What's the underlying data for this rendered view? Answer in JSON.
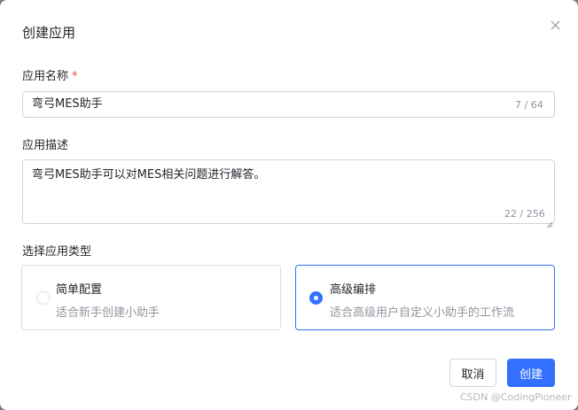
{
  "dialog": {
    "title": "创建应用",
    "close_icon": "close-icon"
  },
  "name_field": {
    "label": "应用名称",
    "required_mark": "*",
    "value": "弯弓MES助手",
    "counter": "7 / 64"
  },
  "description_field": {
    "label": "应用描述",
    "value": "弯弓MES助手可以对MES相关问题进行解答。",
    "counter": "22 / 256"
  },
  "app_type": {
    "label": "选择应用类型",
    "options": [
      {
        "title": "简单配置",
        "subtitle": "适合新手创建小助手",
        "selected": false
      },
      {
        "title": "高级编排",
        "subtitle": "适合高级用户自定义小助手的工作流",
        "selected": true
      }
    ]
  },
  "footer": {
    "cancel_label": "取消",
    "create_label": "创建"
  },
  "watermark": "CSDN @CodingPioneer",
  "colors": {
    "accent": "#3370ff",
    "required": "#f54a45",
    "muted_text": "#8f959e"
  }
}
